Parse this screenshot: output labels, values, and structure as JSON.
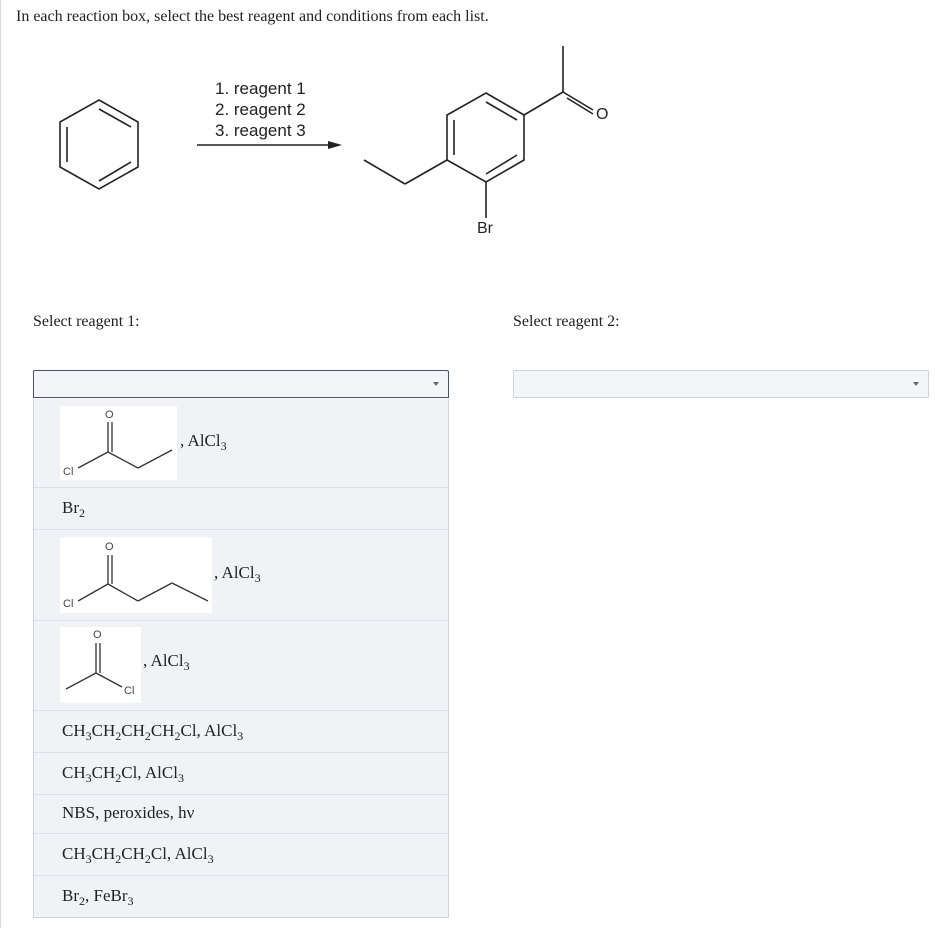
{
  "question": {
    "instruction": "In each reaction box, select the best reagent and conditions from each list."
  },
  "scheme": {
    "conditions": [
      "1. reagent 1",
      "2. reagent 2",
      "3. reagent 3"
    ],
    "atoms": {
      "oxygen": "O",
      "bromine": "Br"
    }
  },
  "select1": {
    "label": "Select reagent 1:",
    "selected": "",
    "options": [
      {
        "type": "structure",
        "structure_atoms": [
          "O",
          "Cl"
        ],
        "suffix_pre": ", AlCl",
        "suffix_sub": "3"
      },
      {
        "type": "text",
        "parts": [
          "Br",
          "2",
          ""
        ]
      },
      {
        "type": "structure",
        "structure_atoms": [
          "O",
          "Cl"
        ],
        "suffix_pre": ", AlCl",
        "suffix_sub": "3"
      },
      {
        "type": "structure",
        "structure_atoms": [
          "O",
          "Cl"
        ],
        "suffix_pre": ", AlCl",
        "suffix_sub": "3"
      },
      {
        "type": "text",
        "parts": [
          "CH",
          "3",
          "CH",
          "2",
          "CH",
          "2",
          "CH",
          "2",
          "Cl, AlCl",
          "3"
        ]
      },
      {
        "type": "text",
        "parts": [
          "CH",
          "3",
          "CH",
          "2",
          "Cl, AlCl",
          "3"
        ]
      },
      {
        "type": "text",
        "text": "NBS, peroxides, hν"
      },
      {
        "type": "text",
        "parts": [
          "CH",
          "3",
          "CH",
          "2",
          "CH",
          "2",
          "Cl, AlCl",
          "3"
        ]
      },
      {
        "type": "text",
        "parts": [
          "Br",
          "2",
          ", FeBr",
          "3"
        ]
      }
    ]
  },
  "select2": {
    "label": "Select reagent 2:",
    "selected": ""
  }
}
